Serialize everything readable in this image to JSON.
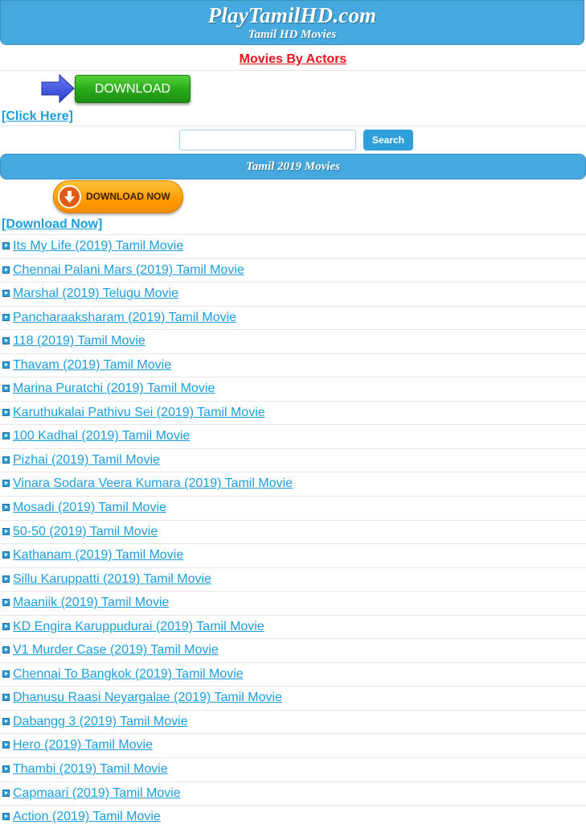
{
  "header": {
    "site_title": "PlayTamilHD.com",
    "subtitle": "Tamil HD Movies"
  },
  "actors_link": "Movies By Actors",
  "download_button": "DOWNLOAD",
  "click_here": "[Click Here]",
  "search": {
    "placeholder": "",
    "button_label": "Search"
  },
  "section_title": "Tamil 2019 Movies",
  "download_now_button": "DOWNLOAD NOW",
  "download_now_link": "[Download Now]",
  "movies": [
    "Its My Life (2019) Tamil Movie",
    "Chennai Palani Mars (2019) Tamil Movie",
    "Marshal (2019) Telugu Movie",
    "Pancharaaksharam (2019) Tamil Movie",
    "118 (2019) Tamil Movie",
    "Thavam (2019) Tamil Movie",
    "Marina Puratchi (2019) Tamil Movie",
    "Karuthukalai Pathivu Sei (2019) Tamil Movie",
    "100 Kadhal (2019) Tamil Movie",
    "Pizhai (2019) Tamil Movie",
    "Vinara Sodara Veera Kumara (2019) Tamil Movie",
    "Mosadi (2019) Tamil Movie",
    "50-50 (2019) Tamil Movie",
    "Kathanam (2019) Tamil Movie",
    "Sillu Karuppatti (2019) Tamil Movie",
    "Maaniik (2019) Tamil Movie",
    "KD Engira Karuppudurai (2019) Tamil Movie",
    "V1 Murder Case (2019) Tamil Movie",
    "Chennai To Bangkok (2019) Tamil Movie",
    "Dhanusu Raasi Neyargalae (2019) Tamil Movie",
    "Dabangg 3 (2019) Tamil Movie",
    "Hero (2019) Tamil Movie",
    "Thambi (2019) Tamil Movie",
    "Capmaari (2019) Tamil Movie",
    "Action (2019) Tamil Movie"
  ],
  "colors": {
    "header_blue": "#45a9df",
    "link_blue": "#1a9ee0",
    "actors_red": "#e8141e",
    "download_green": "#28a81a",
    "download_orange": "#ff9b00"
  }
}
